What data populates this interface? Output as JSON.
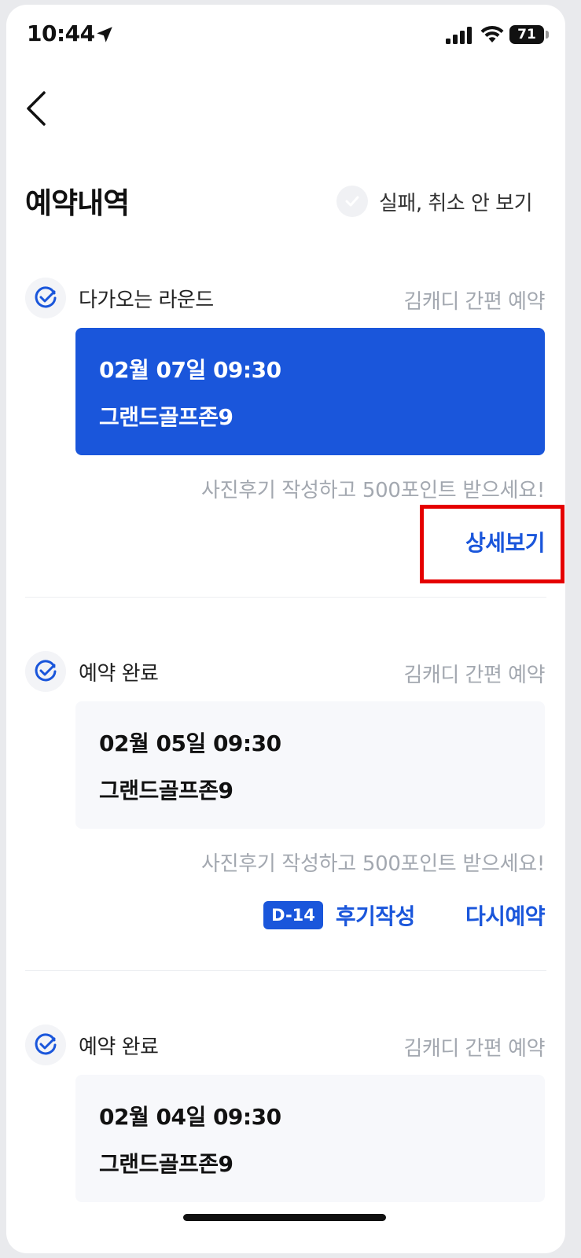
{
  "status": {
    "time": "10:44",
    "battery": "71"
  },
  "header": {
    "title": "예약내역",
    "filter_label": "실패, 취소 안 보기"
  },
  "reservations": [
    {
      "status_label": "다가오는 라운드",
      "type_label": "김캐디 간편 예약",
      "datetime": "02월 07일 09:30",
      "venue": "그랜드골프존9",
      "promo": "사진후기 작성하고 500포인트 받으세요!",
      "action_label": "상세보기"
    },
    {
      "status_label": "예약 완료",
      "type_label": "김캐디 간편 예약",
      "datetime": "02월 05일 09:30",
      "venue": "그랜드골프존9",
      "promo": "사진후기 작성하고 500포인트 받으세요!",
      "dday": "D-14",
      "review_label": "후기작성",
      "rebook_label": "다시예약"
    },
    {
      "status_label": "예약 완료",
      "type_label": "김캐디 간편 예약",
      "datetime": "02월 04일 09:30",
      "venue": "그랜드골프존9"
    }
  ],
  "colors": {
    "accent": "#1a56db",
    "muted": "#a3a8b0",
    "highlight": "#e50000"
  }
}
